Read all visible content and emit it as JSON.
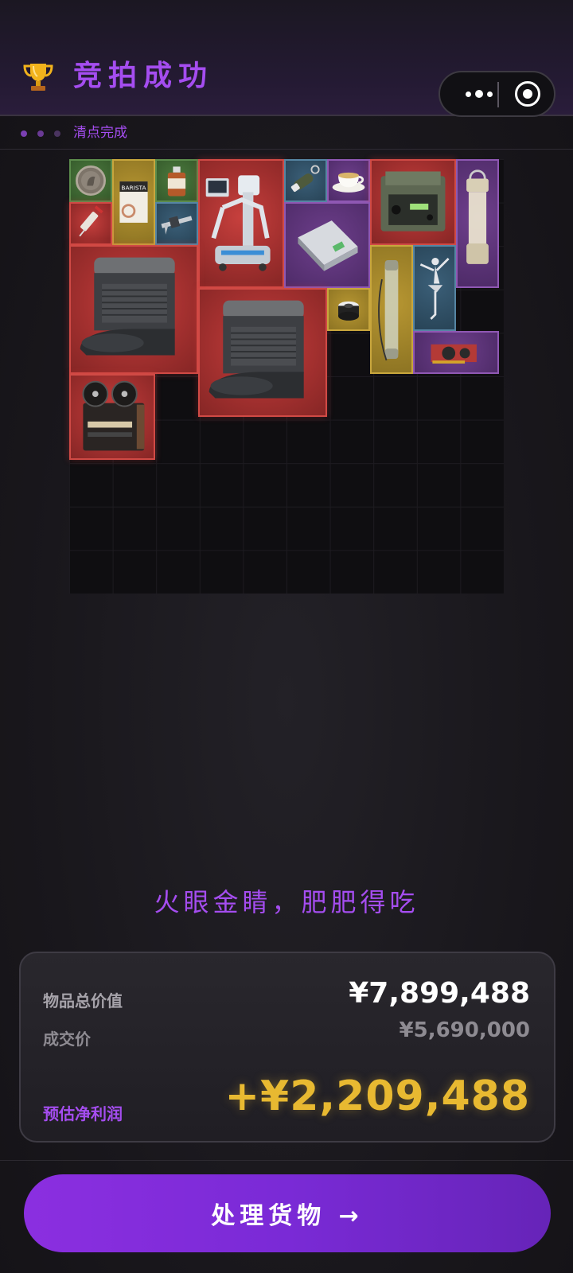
{
  "header": {
    "title": "竞拍成功",
    "trophy_icon": "trophy-icon",
    "capsule": {
      "more_icon": "more-dots-icon",
      "close_icon": "target-close-icon"
    }
  },
  "status": {
    "dots": [
      "#7b3fb3",
      "#6a3a95",
      "#4a3460"
    ],
    "text": "清点完成"
  },
  "items": [
    {
      "name": "coin",
      "rarity": "green"
    },
    {
      "name": "barista-coffee-box",
      "rarity": "gold"
    },
    {
      "name": "medicine-bottle",
      "rarity": "green"
    },
    {
      "name": "surgical-robot",
      "rarity": "red"
    },
    {
      "name": "usb-flash-drive",
      "rarity": "blue"
    },
    {
      "name": "teacup",
      "rarity": "purple"
    },
    {
      "name": "military-radio",
      "rarity": "red"
    },
    {
      "name": "lantern",
      "rarity": "purple"
    },
    {
      "name": "syringe",
      "rarity": "red"
    },
    {
      "name": "caliper",
      "rarity": "blue"
    },
    {
      "name": "hard-drive",
      "rarity": "purple"
    },
    {
      "name": "robot-vacuum-station",
      "rarity": "red"
    },
    {
      "name": "robot-vacuum-station",
      "rarity": "red"
    },
    {
      "name": "gas-mask-filter",
      "rarity": "gold"
    },
    {
      "name": "glass-tube",
      "rarity": "gold"
    },
    {
      "name": "ballerina-statue",
      "rarity": "blue"
    },
    {
      "name": "graphics-card",
      "rarity": "purple"
    },
    {
      "name": "reel-tape-recorder",
      "rarity": "red"
    }
  ],
  "slogan": "火眼金睛，肥肥得吃",
  "summary": {
    "total_label": "物品总价值",
    "total_value": "¥7,899,488",
    "deal_label": "成交价",
    "deal_value": "¥5,690,000",
    "profit_label": "预估净利润",
    "profit_value": "+¥2,209,488"
  },
  "cta": {
    "label": "处理货物 →"
  },
  "colors": {
    "accent_purple": "#a54df0",
    "profit_gold": "#e8b931",
    "rarity_red": "#c7403d",
    "rarity_gold": "#b89732",
    "rarity_green": "#4c7a3e",
    "rarity_blue": "#3b5f78",
    "rarity_purple": "#6e3f8c"
  }
}
